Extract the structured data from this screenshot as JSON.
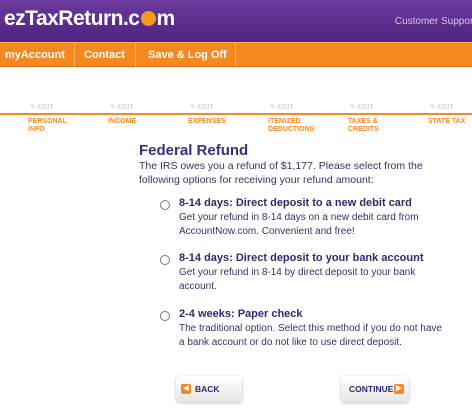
{
  "header": {
    "logo_left": "ezTaxReturn.c",
    "logo_right": "m",
    "customer_support": "Customer Support"
  },
  "nav": {
    "items": [
      "myAccount",
      "Contact",
      "Save & Log Off"
    ]
  },
  "steps": [
    {
      "edit": "✎ EDIT",
      "label": "PERSONAL\nINFO"
    },
    {
      "edit": "✎ EDIT",
      "label": "INCOME"
    },
    {
      "edit": "✎ EDIT",
      "label": "EXPENSES"
    },
    {
      "edit": "✎ EDIT",
      "label": "ITEMIZED\nDEDUCTIONS"
    },
    {
      "edit": "✎ EDIT",
      "label": "TAXES &\nCREDITS"
    },
    {
      "edit": "✎ EDIT",
      "label": "STATE TAX"
    }
  ],
  "main": {
    "title": "Federal Refund",
    "intro": "The IRS owes you a refund of $1,177. Please select from the following options for receiving your refund amount:",
    "options": [
      {
        "title": "8-14 days: Direct deposit to a new debit card",
        "desc": "Get your refund in 8-14 days on a new debit card from AccountNow.com. Convenient and free!"
      },
      {
        "title": "8-14 days: Direct deposit to your bank account",
        "desc": "Get your refund in 8-14 by direct deposit to your bank account."
      },
      {
        "title": "2-4 weeks: Paper check",
        "desc": "The traditional option. Select this method if you do not have a bank account or do not like to use direct deposit."
      }
    ]
  },
  "buttons": {
    "back": "BACK",
    "continue": "CONTINUE"
  },
  "colors": {
    "brand_purple": "#5a2d8c",
    "accent_orange": "#f5891f",
    "text_navy": "#2b2b6e"
  }
}
